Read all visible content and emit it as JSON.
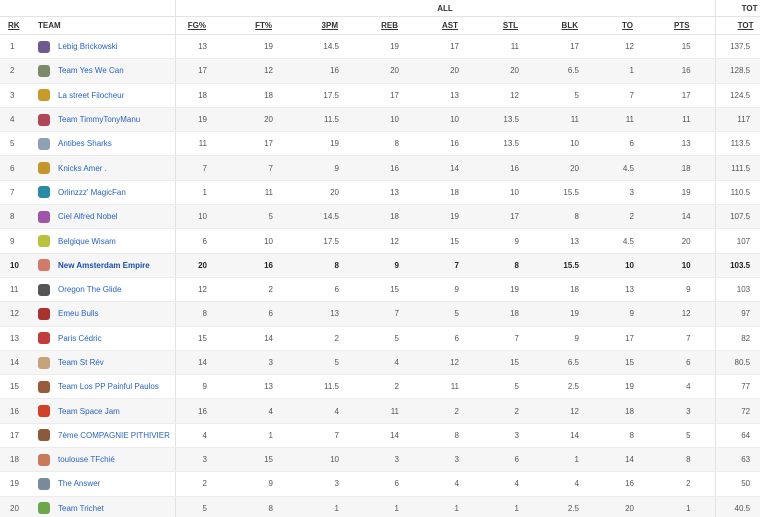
{
  "header": {
    "group_all": "ALL",
    "group_tot": "TOT",
    "columns": {
      "rk": "RK",
      "team": "TEAM",
      "fg": "FG%",
      "ft": "FT%",
      "tpm": "3PM",
      "reb": "REB",
      "ast": "AST",
      "stl": "STL",
      "blk": "BLK",
      "to": "TO",
      "pts": "PTS",
      "tot": "TOT"
    }
  },
  "rows": [
    {
      "rk": "1",
      "team": "Lebig Brickowski",
      "fg": "13",
      "ft": "19",
      "tpm": "14.5",
      "reb": "19",
      "ast": "17",
      "stl": "11",
      "blk": "17",
      "to": "12",
      "pts": "15",
      "tot": "137.5",
      "logo": "#6d5a8f"
    },
    {
      "rk": "2",
      "team": "Team Yes We Can",
      "fg": "17",
      "ft": "12",
      "tpm": "16",
      "reb": "20",
      "ast": "20",
      "stl": "20",
      "blk": "6.5",
      "to": "1",
      "pts": "16",
      "tot": "128.5",
      "logo": "#7a8a6a"
    },
    {
      "rk": "3",
      "team": "La street Filocheur",
      "fg": "18",
      "ft": "18",
      "tpm": "17.5",
      "reb": "17",
      "ast": "13",
      "stl": "12",
      "blk": "5",
      "to": "7",
      "pts": "17",
      "tot": "124.5",
      "logo": "#c89a2a"
    },
    {
      "rk": "4",
      "team": "Team TimmyTonyManu",
      "fg": "19",
      "ft": "20",
      "tpm": "11.5",
      "reb": "10",
      "ast": "10",
      "stl": "13.5",
      "blk": "11",
      "to": "11",
      "pts": "11",
      "tot": "117",
      "logo": "#b0455a"
    },
    {
      "rk": "5",
      "team": "Antibes Sharks",
      "fg": "11",
      "ft": "17",
      "tpm": "19",
      "reb": "8",
      "ast": "16",
      "stl": "13.5",
      "blk": "10",
      "to": "6",
      "pts": "13",
      "tot": "113.5",
      "logo": "#8fa0b5"
    },
    {
      "rk": "6",
      "team": "Knicks Amer .",
      "fg": "7",
      "ft": "7",
      "tpm": "9",
      "reb": "16",
      "ast": "14",
      "stl": "16",
      "blk": "20",
      "to": "4.5",
      "pts": "18",
      "tot": "111.5",
      "logo": "#c7952c"
    },
    {
      "rk": "7",
      "team": "Orlinzzz' MagicFan",
      "fg": "1",
      "ft": "11",
      "tpm": "20",
      "reb": "13",
      "ast": "18",
      "stl": "10",
      "blk": "15.5",
      "to": "3",
      "pts": "19",
      "tot": "110.5",
      "logo": "#2a8aa8"
    },
    {
      "rk": "8",
      "team": "Ciel Alfred Nobel",
      "fg": "10",
      "ft": "5",
      "tpm": "14.5",
      "reb": "18",
      "ast": "19",
      "stl": "17",
      "blk": "8",
      "to": "2",
      "pts": "14",
      "tot": "107.5",
      "logo": "#a056a8"
    },
    {
      "rk": "9",
      "team": "Belgique Wisam",
      "fg": "6",
      "ft": "10",
      "tpm": "17.5",
      "reb": "12",
      "ast": "15",
      "stl": "9",
      "blk": "13",
      "to": "4.5",
      "pts": "20",
      "tot": "107",
      "logo": "#b8c23a"
    },
    {
      "rk": "10",
      "team": "New Amsterdam Empire",
      "fg": "20",
      "ft": "16",
      "tpm": "8",
      "reb": "9",
      "ast": "7",
      "stl": "8",
      "blk": "15.5",
      "to": "10",
      "pts": "10",
      "tot": "103.5",
      "logo": "#d07a6a",
      "me": true
    },
    {
      "rk": "11",
      "team": "Oregon The Glide",
      "fg": "12",
      "ft": "2",
      "tpm": "6",
      "reb": "15",
      "ast": "9",
      "stl": "19",
      "blk": "18",
      "to": "13",
      "pts": "9",
      "tot": "103",
      "logo": "#555555"
    },
    {
      "rk": "12",
      "team": "Emeu Bulls",
      "fg": "8",
      "ft": "6",
      "tpm": "13",
      "reb": "7",
      "ast": "5",
      "stl": "18",
      "blk": "19",
      "to": "9",
      "pts": "12",
      "tot": "97",
      "logo": "#a8322e"
    },
    {
      "rk": "13",
      "team": "Paris Cédric",
      "fg": "15",
      "ft": "14",
      "tpm": "2",
      "reb": "5",
      "ast": "6",
      "stl": "7",
      "blk": "9",
      "to": "17",
      "pts": "7",
      "tot": "82",
      "logo": "#c23a3a"
    },
    {
      "rk": "14",
      "team": "Team St Rév",
      "fg": "14",
      "ft": "3",
      "tpm": "5",
      "reb": "4",
      "ast": "12",
      "stl": "15",
      "blk": "6.5",
      "to": "15",
      "pts": "6",
      "tot": "80.5",
      "logo": "#c8a27a"
    },
    {
      "rk": "15",
      "team": "Team Los PP Painful Paulos",
      "fg": "9",
      "ft": "13",
      "tpm": "11.5",
      "reb": "2",
      "ast": "11",
      "stl": "5",
      "blk": "2.5",
      "to": "19",
      "pts": "4",
      "tot": "77",
      "logo": "#9a5a3a"
    },
    {
      "rk": "16",
      "team": "Team Space Jam",
      "fg": "16",
      "ft": "4",
      "tpm": "4",
      "reb": "11",
      "ast": "2",
      "stl": "2",
      "blk": "12",
      "to": "18",
      "pts": "3",
      "tot": "72",
      "logo": "#d0402a"
    },
    {
      "rk": "17",
      "team": "7ème COMPAGNIE PITHIVIER",
      "fg": "4",
      "ft": "1",
      "tpm": "7",
      "reb": "14",
      "ast": "8",
      "stl": "3",
      "blk": "14",
      "to": "8",
      "pts": "5",
      "tot": "64",
      "logo": "#8a5a3a"
    },
    {
      "rk": "18",
      "team": "toulouse TFchié",
      "fg": "3",
      "ft": "15",
      "tpm": "10",
      "reb": "3",
      "ast": "3",
      "stl": "6",
      "blk": "1",
      "to": "14",
      "pts": "8",
      "tot": "63",
      "logo": "#c87a5a"
    },
    {
      "rk": "19",
      "team": "The Answer",
      "fg": "2",
      "ft": "9",
      "tpm": "3",
      "reb": "6",
      "ast": "4",
      "stl": "4",
      "blk": "4",
      "to": "16",
      "pts": "2",
      "tot": "50",
      "logo": "#7a8a9a"
    },
    {
      "rk": "20",
      "team": "Team Trichet",
      "fg": "5",
      "ft": "8",
      "tpm": "1",
      "reb": "1",
      "ast": "1",
      "stl": "1",
      "blk": "2.5",
      "to": "20",
      "pts": "1",
      "tot": "40.5",
      "logo": "#6aa84a"
    }
  ]
}
